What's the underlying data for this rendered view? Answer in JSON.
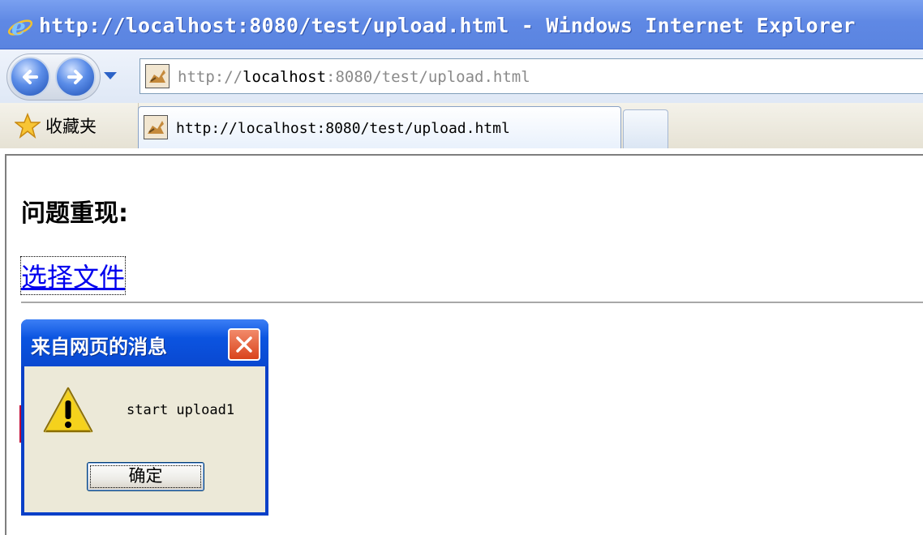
{
  "window": {
    "title": "http://localhost:8080/test/upload.html - Windows Internet Explorer"
  },
  "toolbar": {
    "back_icon": "back-arrow-icon",
    "forward_icon": "forward-arrow-icon",
    "dropdown_icon": "chevron-down-icon",
    "address": {
      "scheme": "http://",
      "host": "localhost",
      "rest": ":8080/test/upload.html"
    }
  },
  "favorites": {
    "label": "收藏夹",
    "icon": "star-icon"
  },
  "tabs": [
    {
      "label": "http://localhost:8080/test/upload.html",
      "active": true
    }
  ],
  "page": {
    "heading": "问题重现:",
    "link_label": "选择文件"
  },
  "dialog": {
    "title": "来自网页的消息",
    "message": "start upload1",
    "ok_label": "确定",
    "icon": "warning-icon"
  },
  "colors": {
    "titlebar": "#5a84e0",
    "dialog_blue": "#0a48d0",
    "link": "#0000ee",
    "close_red": "#d9441c"
  }
}
